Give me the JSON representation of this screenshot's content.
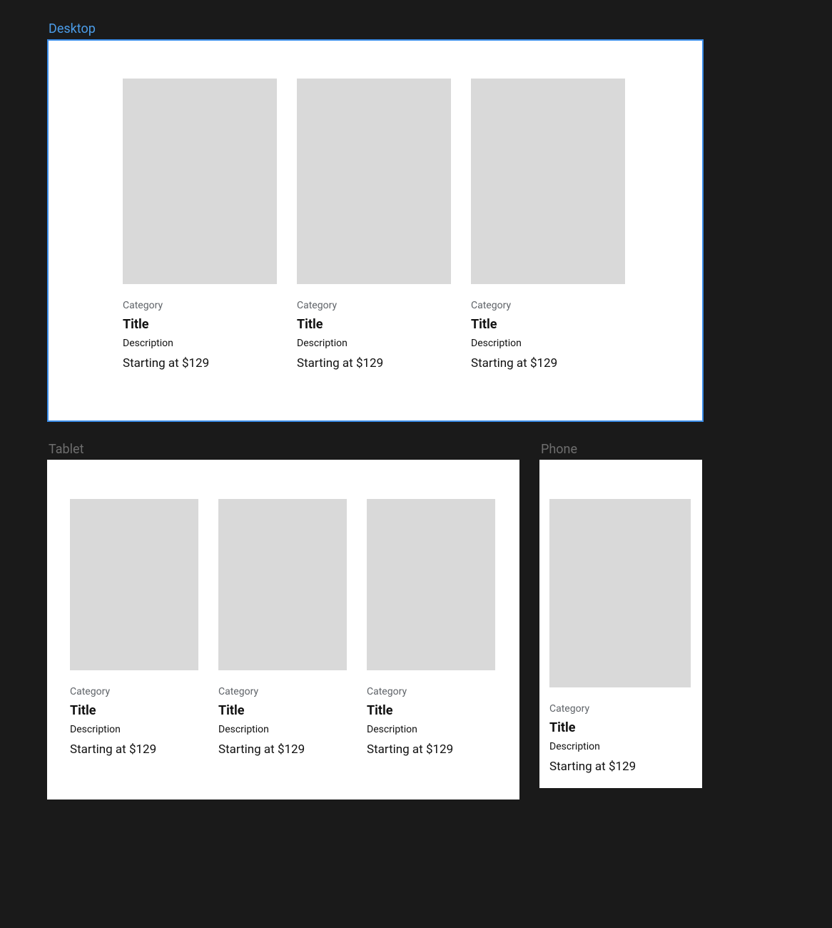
{
  "sections": {
    "desktop": {
      "label": "Desktop"
    },
    "tablet": {
      "label": "Tablet"
    },
    "phone": {
      "label": "Phone"
    }
  },
  "card": {
    "category": "Category",
    "title": "Title",
    "description": "Description",
    "price": "Starting at $129"
  }
}
